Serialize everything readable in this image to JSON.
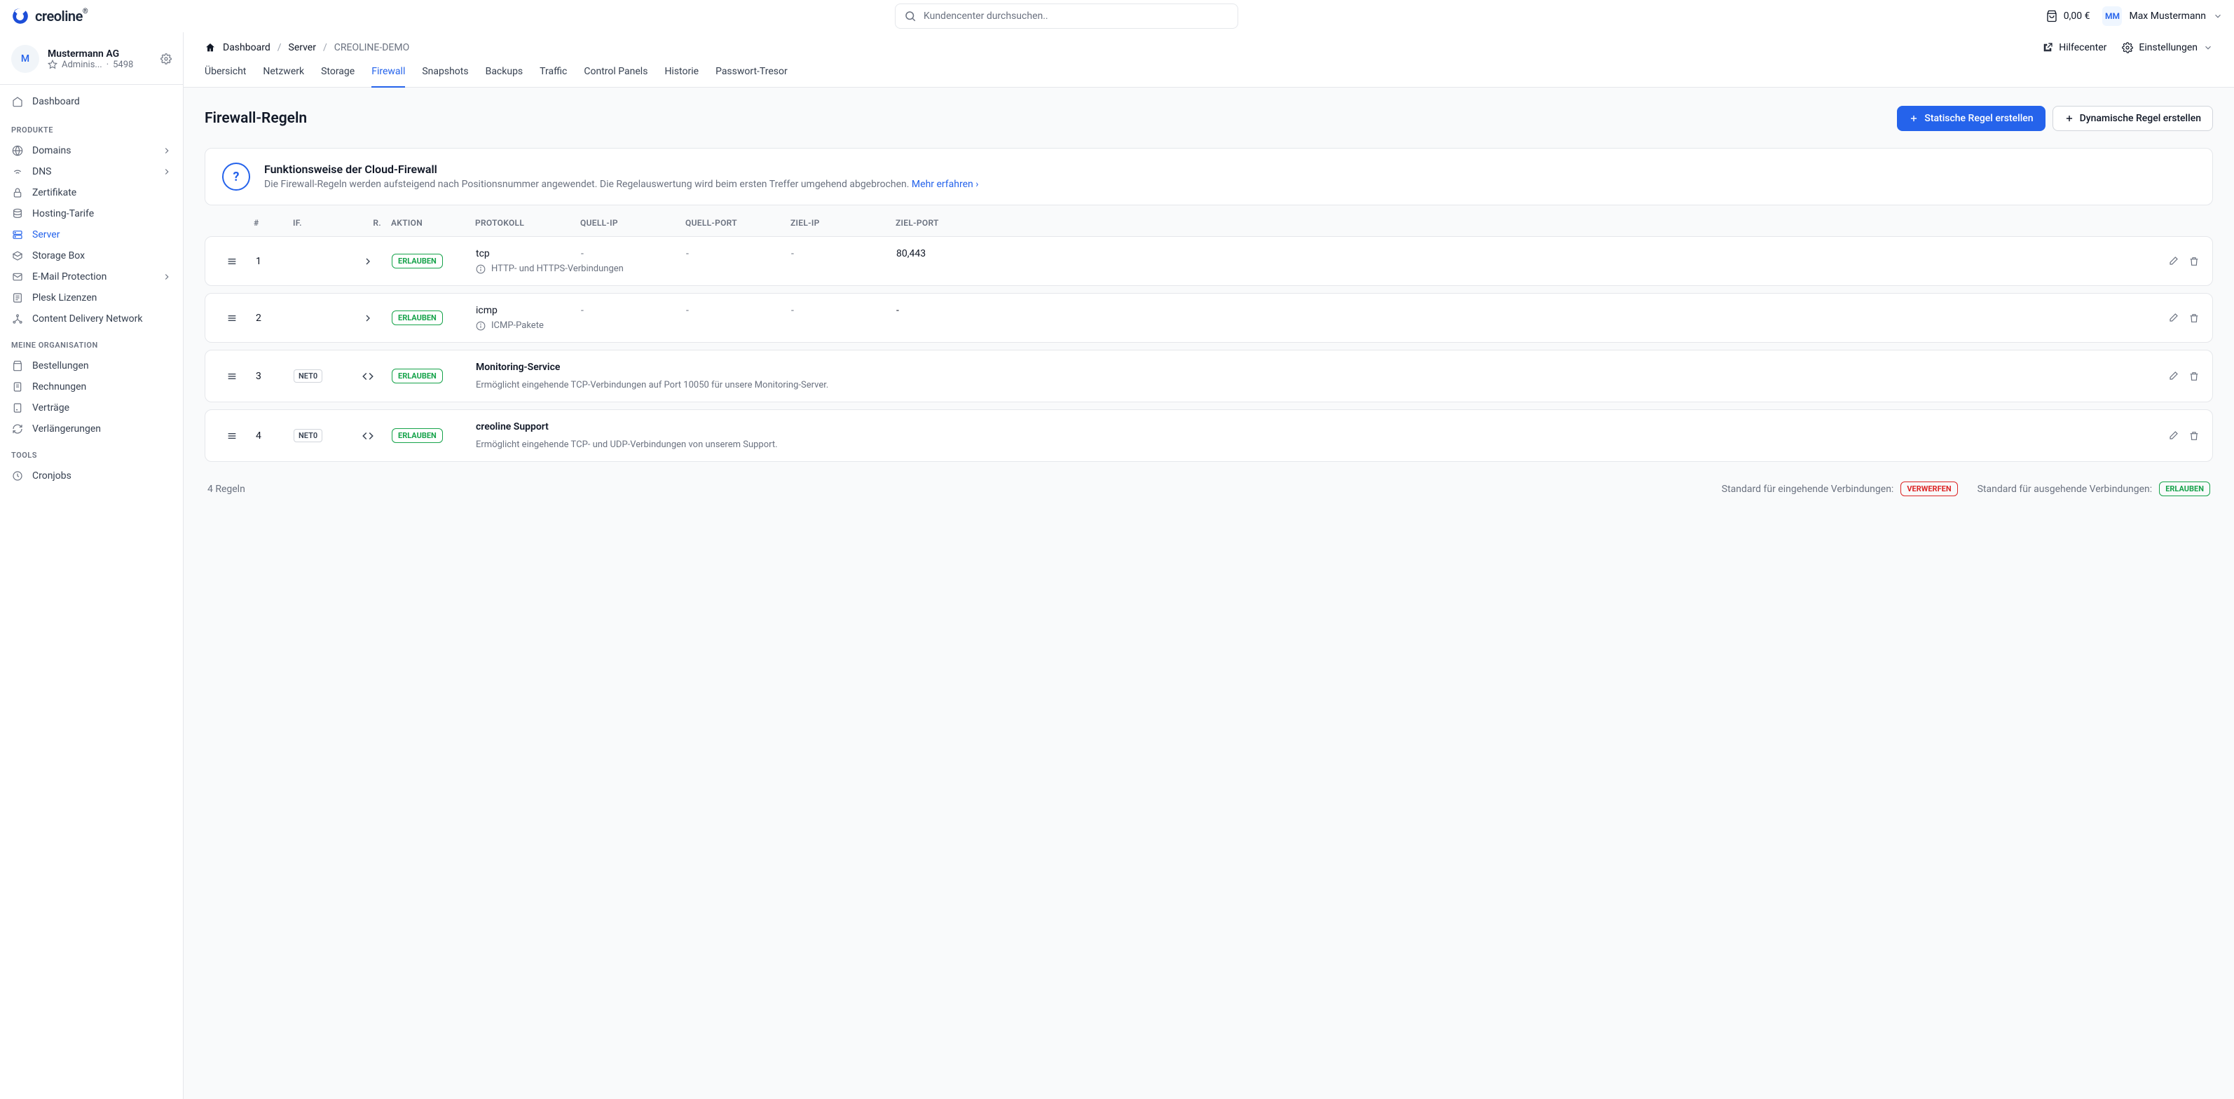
{
  "brand": "creoline",
  "search": {
    "placeholder": "Kundencenter durchsuchen.."
  },
  "cart": {
    "amount": "0,00 €"
  },
  "user": {
    "initials": "MM",
    "name": "Max Mustermann"
  },
  "org": {
    "initial": "M",
    "name": "Mustermann AG",
    "role": "Adminis...",
    "id": "5498"
  },
  "nav": {
    "dashboard": "Dashboard",
    "group_products": "PRODUKTE",
    "domains": "Domains",
    "dns": "DNS",
    "zertifikate": "Zertifikate",
    "hosting": "Hosting-Tarife",
    "server": "Server",
    "storage": "Storage Box",
    "email": "E-Mail Protection",
    "plesk": "Plesk Lizenzen",
    "cdn": "Content Delivery Network",
    "group_org": "MEINE ORGANISATION",
    "bestellungen": "Bestellungen",
    "rechnungen": "Rechnungen",
    "vertraege": "Verträge",
    "verlaengerungen": "Verlängerungen",
    "group_tools": "TOOLS",
    "cronjobs": "Cronjobs"
  },
  "breadcrumb": {
    "dashboard": "Dashboard",
    "server": "Server",
    "current": "CREOLINE-DEMO"
  },
  "header_actions": {
    "help": "Hilfecenter",
    "settings": "Einstellungen"
  },
  "tabs": [
    "Übersicht",
    "Netzwerk",
    "Storage",
    "Firewall",
    "Snapshots",
    "Backups",
    "Traffic",
    "Control Panels",
    "Historie",
    "Passwort-Tresor"
  ],
  "active_tab": 3,
  "page_title": "Firewall-Regeln",
  "buttons": {
    "static": "Statische Regel erstellen",
    "dynamic": "Dynamische Regel erstellen"
  },
  "info": {
    "title": "Funktionsweise der Cloud-Firewall",
    "desc": "Die Firewall-Regeln werden aufsteigend nach Positionsnummer angewendet. Die Regelauswertung wird beim ersten Treffer umgehend abgebrochen. ",
    "link": "Mehr erfahren"
  },
  "columns": {
    "num": "#",
    "if": "IF.",
    "r": "R.",
    "aktion": "AKTION",
    "protokoll": "PROTOKOLL",
    "quellip": "QUELL-IP",
    "quellport": "QUELL-PORT",
    "zielip": "ZIEL-IP",
    "zielport": "ZIEL-PORT"
  },
  "rules": [
    {
      "num": "1",
      "if": "",
      "dir": "in",
      "action": "ERLAUBEN",
      "proto": "tcp",
      "qip": "-",
      "qport": "-",
      "zip": "-",
      "zport": "80,443",
      "desc": "HTTP- und HTTPS-Verbindungen"
    },
    {
      "num": "2",
      "if": "",
      "dir": "in",
      "action": "ERLAUBEN",
      "proto": "icmp",
      "qip": "-",
      "qport": "-",
      "zip": "-",
      "zport": "-",
      "desc": "ICMP-Pakete"
    },
    {
      "num": "3",
      "if": "NET0",
      "dir": "both",
      "action": "ERLAUBEN",
      "title": "Monitoring-Service",
      "desc": "Ermöglicht eingehende TCP-Verbindungen auf Port 10050 für unsere Monitoring-Server."
    },
    {
      "num": "4",
      "if": "NET0",
      "dir": "both",
      "action": "ERLAUBEN",
      "title": "creoline Support",
      "desc": "Ermöglicht eingehende TCP- und UDP-Verbindungen von unserem Support."
    }
  ],
  "footer": {
    "count": "4 Regeln",
    "incoming_label": "Standard für eingehende Verbindungen:",
    "incoming_value": "VERWERFEN",
    "outgoing_label": "Standard für ausgehende Verbindungen:",
    "outgoing_value": "ERLAUBEN"
  }
}
